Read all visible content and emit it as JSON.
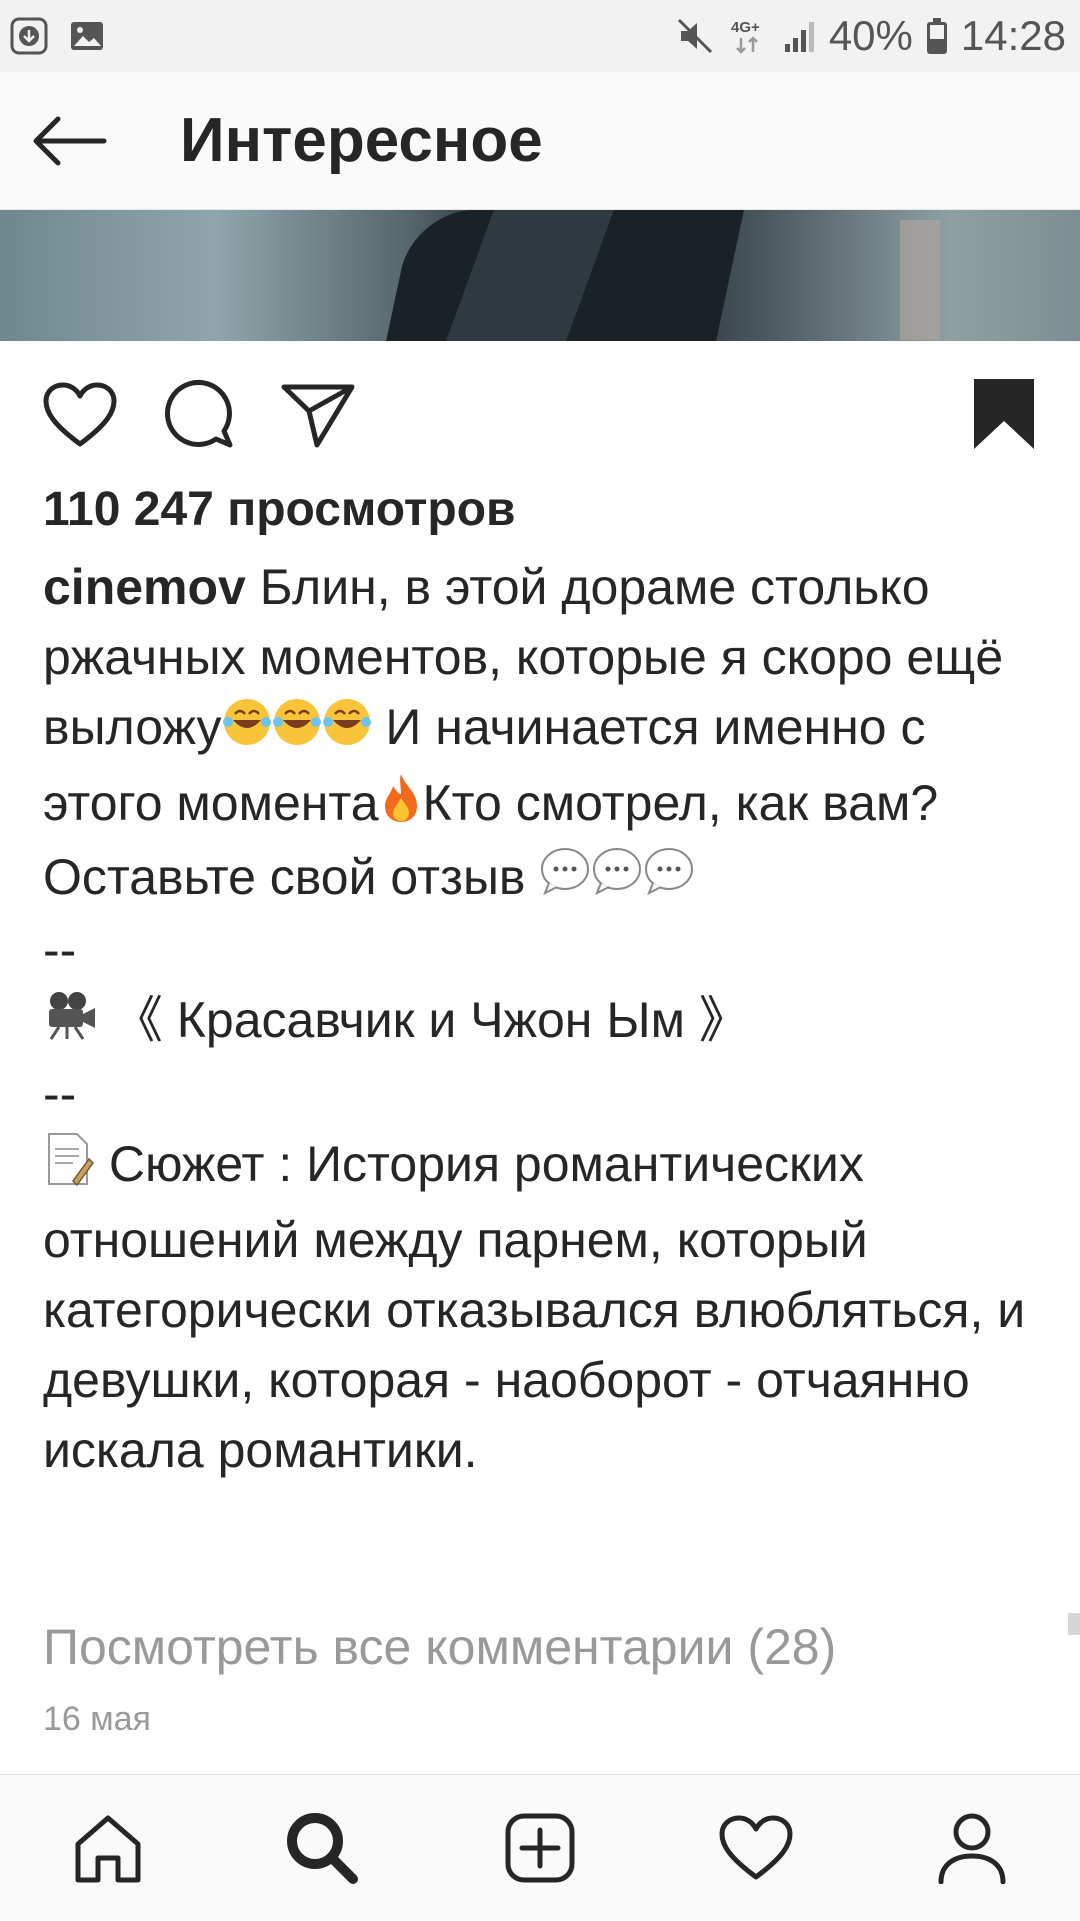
{
  "status_bar": {
    "battery": "40%",
    "time": "14:28",
    "network": "4G+"
  },
  "header": {
    "title": "Интересное"
  },
  "post": {
    "views": "110 247 просмотров",
    "username": "cinemov",
    "caption_lines": [
      "Блин, в этой дораме столько ржачных моментов, которые я скоро ещё выложу",
      "И начинается именно с этого момента",
      "Кто смотрел, как вам?",
      "Оставьте свой отзыв",
      "--",
      "《 Красавчик и Чжон Ым 》",
      "--",
      "Сюжет : История романтических отношений между парнем, который категорически отказывался влюбляться, и девушки, которая - наоборот - отчаянно искала романтики."
    ],
    "view_comments": "Посмотреть все комментарии (28)",
    "date": "16 мая"
  },
  "icons": {
    "back": "arrow-left-icon",
    "like": "heart-outline-icon",
    "comment": "speech-bubble-icon",
    "share": "paper-plane-icon",
    "save": "bookmark-filled-icon",
    "nav": [
      "home-icon",
      "search-icon",
      "add-post-icon",
      "activity-heart-icon",
      "profile-icon"
    ]
  },
  "colors": {
    "text": "#262626",
    "muted": "#999999",
    "status_bg": "#f2f2f2"
  }
}
